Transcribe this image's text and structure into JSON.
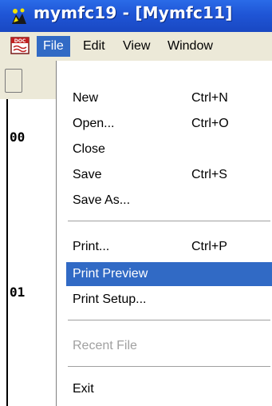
{
  "window": {
    "title": "mymfc19 - [Mymfc11]"
  },
  "menubar": {
    "items": [
      {
        "label": "File",
        "active": true
      },
      {
        "label": "Edit"
      },
      {
        "label": "View"
      },
      {
        "label": "Window"
      }
    ]
  },
  "background": {
    "row_labels": [
      "00",
      "01"
    ]
  },
  "file_menu": {
    "items": [
      {
        "label": "New",
        "shortcut": "Ctrl+N"
      },
      {
        "label": "Open...",
        "shortcut": "Ctrl+O"
      },
      {
        "label": "Close"
      },
      {
        "label": "Save",
        "shortcut": "Ctrl+S"
      },
      {
        "label": "Save As..."
      },
      {
        "label": "Print...",
        "shortcut": "Ctrl+P"
      },
      {
        "label": "Print Preview",
        "highlighted": true
      },
      {
        "label": "Print Setup..."
      },
      {
        "label": "Recent File",
        "disabled": true
      },
      {
        "label": "Exit"
      }
    ]
  },
  "colors": {
    "title_bar": "#1f55d6",
    "highlight": "#316ac5",
    "menu_bg": "#ece9d8",
    "disabled_text": "#a0a0a0"
  }
}
